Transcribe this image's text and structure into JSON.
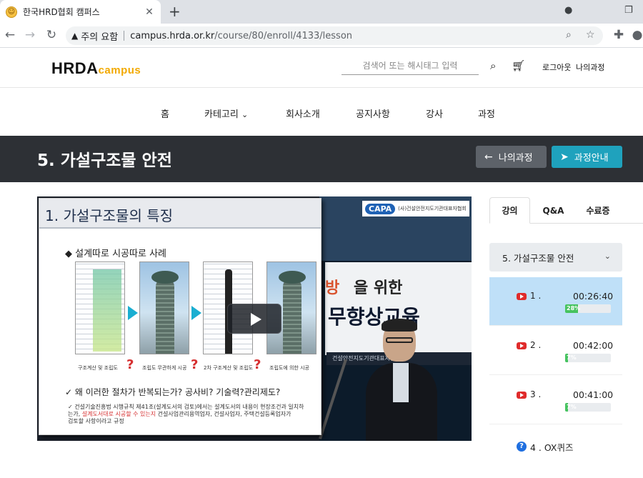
{
  "browser": {
    "tab_title": "한국HRD협회 캠퍼스",
    "security_label": "주의 요함",
    "url_host": "campus.hrda.or.kr",
    "url_path": "/course/80/enroll/4133/lesson"
  },
  "header": {
    "logo_main": "HRDA",
    "logo_sub": "campus",
    "search_placeholder": "검색어 또는 해시태그 입력",
    "logout": "로그아웃",
    "my_courses": "나의과정"
  },
  "nav": {
    "items": [
      "홈",
      "카테고리",
      "회사소개",
      "공지사항",
      "강사",
      "과정"
    ],
    "category_chevron": "⌄"
  },
  "title_band": {
    "title": "5. 가설구조물 안전",
    "btn_my": "나의과정",
    "btn_info": "과정안내"
  },
  "video": {
    "slide_title": "1. 가설구조물의 특징",
    "slide_sub": "◆ 설계따로 시공따로 사례",
    "captions": [
      "구조계산 및 조립도",
      "조립도 무관하게 시공",
      "2차 구조계산 및 조립도",
      "조립도에 의한 시공"
    ],
    "question": "✓ 왜 이러한 절차가 반복되는가? 공사비? 기술력?관리제도?",
    "bullet1": "✓ 건설기술진흥법 시행규칙 제41조(설계도서의 검토)에서는 설계도서의 내용이 현장조건과 일치하",
    "bullet2_pre": "는가, ",
    "bullet2_red": "설계도서대로 시공할 수 있는지",
    "bullet2_post": " 건설사업관리용역업자, 건설사업자, 주택건설등록업자가",
    "bullet3": "검토할 사항이라고 규정",
    "capa_mark": "CAPA",
    "capa_text": "(사)건설안전지도기관대표자협회",
    "board_red": "방",
    "board_dark": "을 위한",
    "board_big": "무향상교육",
    "desk_sign": "건설안전지도기관대표자협회"
  },
  "tabs": [
    "강의",
    "Q&A",
    "수료증"
  ],
  "chapter": "5. 가설구조물 안전",
  "lessons": [
    {
      "num": "1 .",
      "time": "00:26:40",
      "progress": 28,
      "progress_label": "28%",
      "active": true
    },
    {
      "num": "2 .",
      "time": "00:42:00",
      "progress": 7,
      "progress_label": "7%",
      "active": false
    },
    {
      "num": "3 .",
      "time": "00:41:00",
      "progress": 7,
      "progress_label": "7%",
      "active": false
    }
  ],
  "quiz": {
    "num": "4 .",
    "label": "OX퀴즈"
  },
  "colors": {
    "title_band": "#2d3035",
    "btn_info": "#1fa2bd",
    "active_lesson": "#bfe0f8",
    "progress": "#46c35f"
  }
}
